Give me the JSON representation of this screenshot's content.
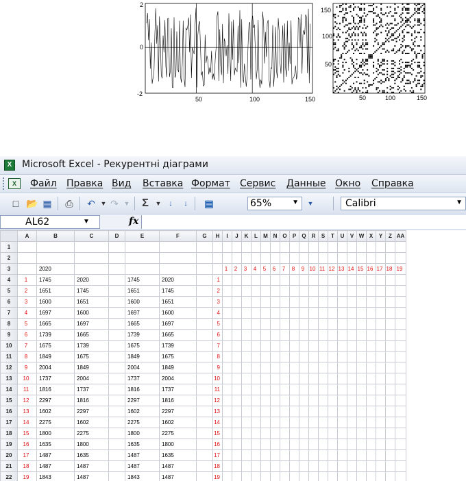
{
  "line_chart": {
    "y_ticks": [
      "2",
      "0",
      "-2"
    ],
    "x_ticks": [
      "50",
      "100",
      "150"
    ]
  },
  "rp_chart": {
    "y_ticks": [
      "150",
      "100",
      "50"
    ],
    "x_ticks": [
      "50",
      "100",
      "150"
    ]
  },
  "window": {
    "title": "Microsoft Excel - Рекурентні діаграми",
    "icon_letter": "X"
  },
  "menu": [
    "Файл",
    "Правка",
    "Вид",
    "Вставка",
    "Формат",
    "Сервис",
    "Данные",
    "Окно",
    "Справка"
  ],
  "toolbar": {
    "zoom": "65%",
    "font": "Calibri",
    "sigma": "Σ"
  },
  "formula_bar": {
    "cell_ref": "AL62",
    "fx": "fx"
  },
  "sheet": {
    "columns": [
      "A",
      "B",
      "C",
      "D",
      "E",
      "F",
      "G",
      "H",
      "I",
      "J",
      "K",
      "L",
      "M",
      "N",
      "O",
      "P",
      "Q",
      "R",
      "S",
      "T",
      "U",
      "V",
      "W",
      "X",
      "Y",
      "Z",
      "AA"
    ],
    "rows": [
      {
        "num": "1",
        "a": "",
        "b": "",
        "c": "",
        "e": "",
        "f": "",
        "h": ""
      },
      {
        "num": "2",
        "a": "",
        "b": "",
        "c": "",
        "e": "",
        "f": "",
        "h": ""
      },
      {
        "num": "3",
        "a": "",
        "b": "2020",
        "c": "",
        "e": "",
        "f": "",
        "h": ""
      },
      {
        "num": "4",
        "a": "1",
        "b": "1745",
        "c": "2020",
        "e": "1745",
        "f": "2020",
        "h": "1"
      },
      {
        "num": "5",
        "a": "2",
        "b": "1651",
        "c": "1745",
        "e": "1651",
        "f": "1745",
        "h": "2"
      },
      {
        "num": "6",
        "a": "3",
        "b": "1600",
        "c": "1651",
        "e": "1600",
        "f": "1651",
        "h": "3"
      },
      {
        "num": "7",
        "a": "4",
        "b": "1697",
        "c": "1600",
        "e": "1697",
        "f": "1600",
        "h": "4"
      },
      {
        "num": "8",
        "a": "5",
        "b": "1665",
        "c": "1697",
        "e": "1665",
        "f": "1697",
        "h": "5"
      },
      {
        "num": "9",
        "a": "6",
        "b": "1739",
        "c": "1665",
        "e": "1739",
        "f": "1665",
        "h": "6"
      },
      {
        "num": "10",
        "a": "7",
        "b": "1675",
        "c": "1739",
        "e": "1675",
        "f": "1739",
        "h": "7"
      },
      {
        "num": "11",
        "a": "8",
        "b": "1849",
        "c": "1675",
        "e": "1849",
        "f": "1675",
        "h": "8"
      },
      {
        "num": "12",
        "a": "9",
        "b": "2004",
        "c": "1849",
        "e": "2004",
        "f": "1849",
        "h": "9"
      },
      {
        "num": "13",
        "a": "10",
        "b": "1737",
        "c": "2004",
        "e": "1737",
        "f": "2004",
        "h": "10"
      },
      {
        "num": "14",
        "a": "11",
        "b": "1816",
        "c": "1737",
        "e": "1816",
        "f": "1737",
        "h": "11"
      },
      {
        "num": "15",
        "a": "12",
        "b": "2297",
        "c": "1816",
        "e": "2297",
        "f": "1816",
        "h": "12"
      },
      {
        "num": "16",
        "a": "13",
        "b": "1602",
        "c": "2297",
        "e": "1602",
        "f": "2297",
        "h": "13"
      },
      {
        "num": "17",
        "a": "14",
        "b": "2275",
        "c": "1602",
        "e": "2275",
        "f": "1602",
        "h": "14"
      },
      {
        "num": "18",
        "a": "15",
        "b": "1800",
        "c": "2275",
        "e": "1800",
        "f": "2275",
        "h": "15"
      },
      {
        "num": "19",
        "a": "16",
        "b": "1635",
        "c": "1800",
        "e": "1635",
        "f": "1800",
        "h": "16"
      },
      {
        "num": "20",
        "a": "17",
        "b": "1487",
        "c": "1635",
        "e": "1487",
        "f": "1635",
        "h": "17"
      },
      {
        "num": "21",
        "a": "18",
        "b": "1487",
        "c": "1487",
        "e": "1487",
        "f": "1487",
        "h": "18"
      },
      {
        "num": "22",
        "a": "19",
        "b": "1843",
        "c": "1487",
        "e": "1843",
        "f": "1487",
        "h": "19"
      }
    ],
    "row3_header_numbers": [
      "1",
      "2",
      "3",
      "4",
      "5",
      "6",
      "7",
      "8",
      "9",
      "10",
      "11",
      "12",
      "13",
      "14",
      "15",
      "16",
      "17",
      "18",
      "19"
    ]
  },
  "colors": {
    "red_text": "#e01010",
    "excel_green": "#1d7b3a"
  }
}
